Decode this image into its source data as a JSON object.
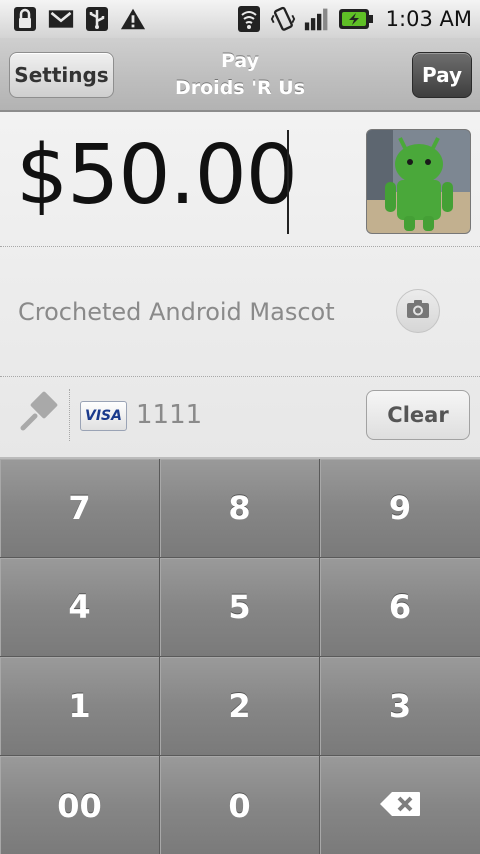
{
  "status_bar": {
    "time": "1:03 AM",
    "left_icons": [
      "lock-icon",
      "gmail-icon",
      "usb-icon",
      "warning-icon"
    ],
    "right_icons": [
      "wifi-icon",
      "vibrate-icon",
      "signal-icon",
      "battery-charging-icon"
    ],
    "colors": {
      "battery": "#5fbf26"
    }
  },
  "title_bar": {
    "settings_label": "Settings",
    "title_line1": "Pay",
    "title_line2": "Droids 'R Us",
    "pay_label": "Pay"
  },
  "payment": {
    "amount": "$50.00",
    "description": "Crocheted Android Mascot",
    "card_brand": "VISA",
    "card_last4": "1111",
    "clear_label": "Clear"
  },
  "keypad": {
    "keys": [
      "7",
      "8",
      "9",
      "4",
      "5",
      "6",
      "1",
      "2",
      "3",
      "00",
      "0"
    ],
    "backspace_icon": "backspace-icon"
  }
}
